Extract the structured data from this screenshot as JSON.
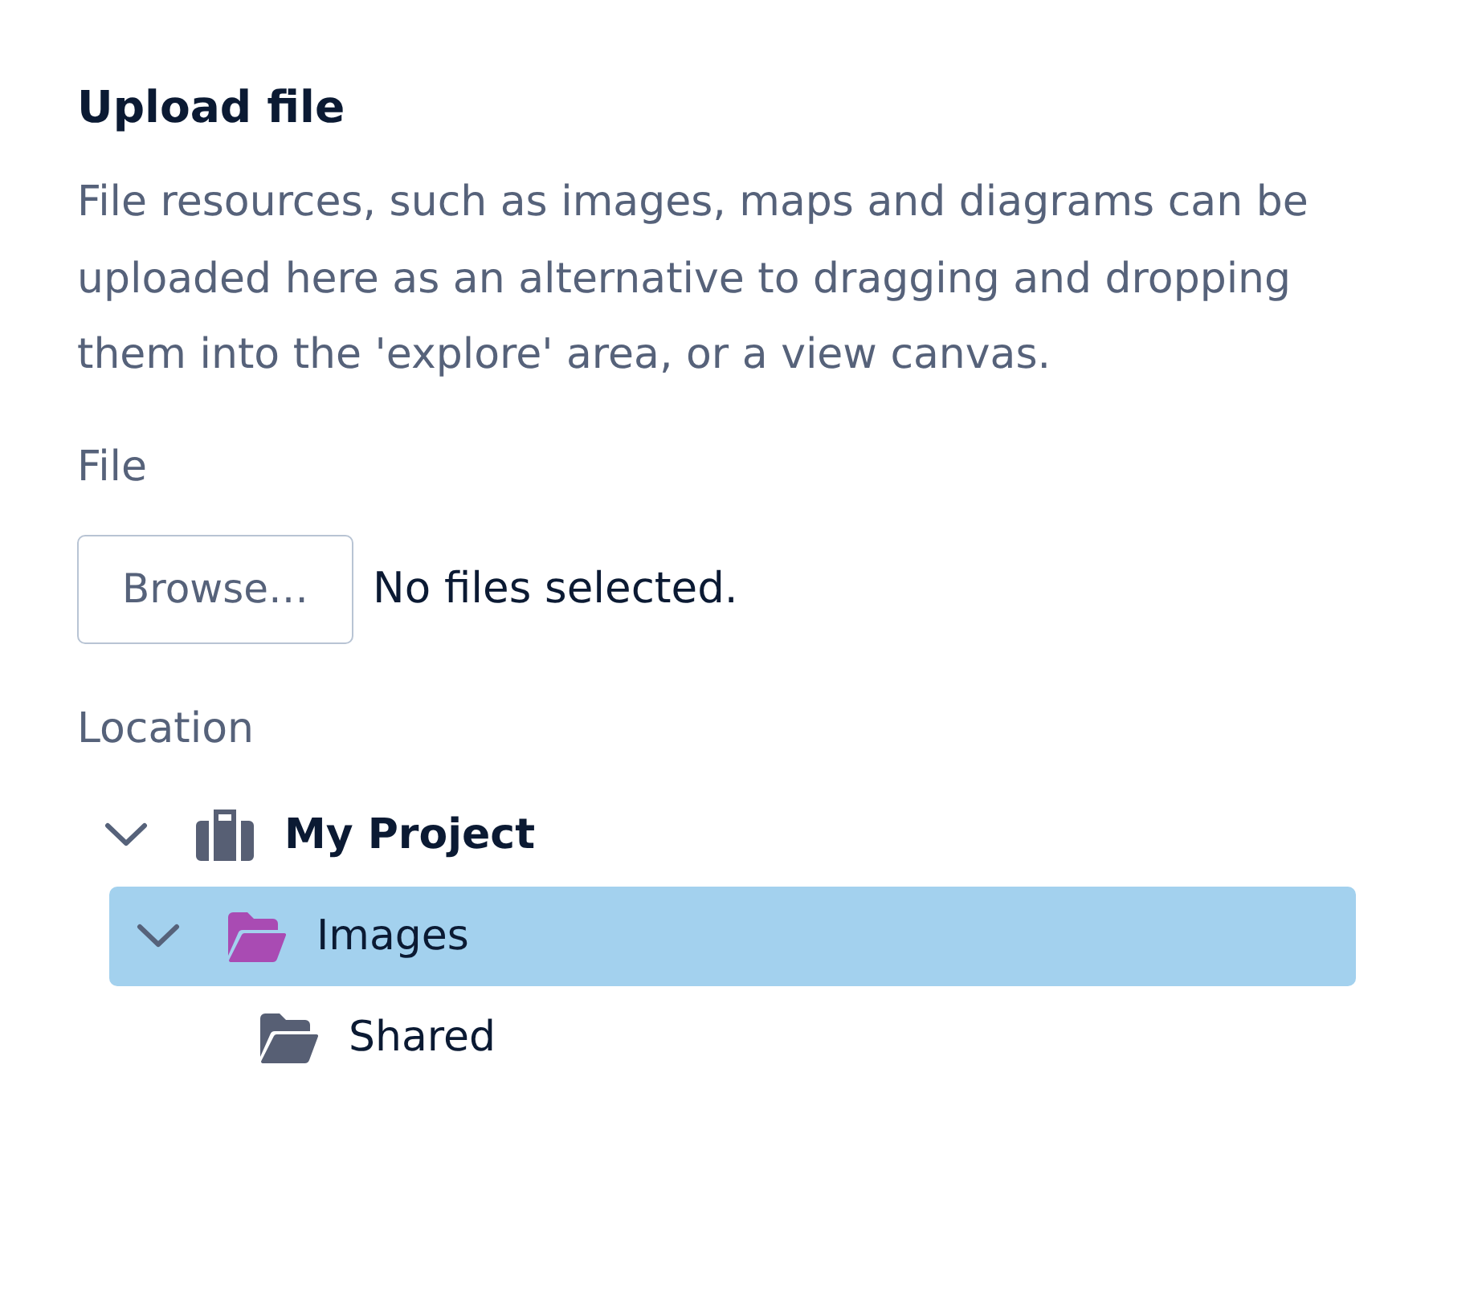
{
  "title": "Upload file",
  "description": "File resources, such as images, maps and diagrams can be uploaded here as an alternative to dragging and dropping them into the 'explore' area, or a view canvas.",
  "file_field": {
    "label": "File",
    "button": "Browse…",
    "status": "No files selected."
  },
  "location": {
    "label": "Location",
    "tree": [
      {
        "label": "My Project",
        "kind": "project",
        "color": "#575f74",
        "expanded": true,
        "selected": false,
        "children": [
          {
            "label": "Images",
            "kind": "folder",
            "color": "#a94bb3",
            "expanded": true,
            "selected": true,
            "children": [
              {
                "label": "Shared",
                "kind": "folder",
                "color": "#575f74",
                "selected": false
              }
            ]
          }
        ]
      }
    ]
  }
}
